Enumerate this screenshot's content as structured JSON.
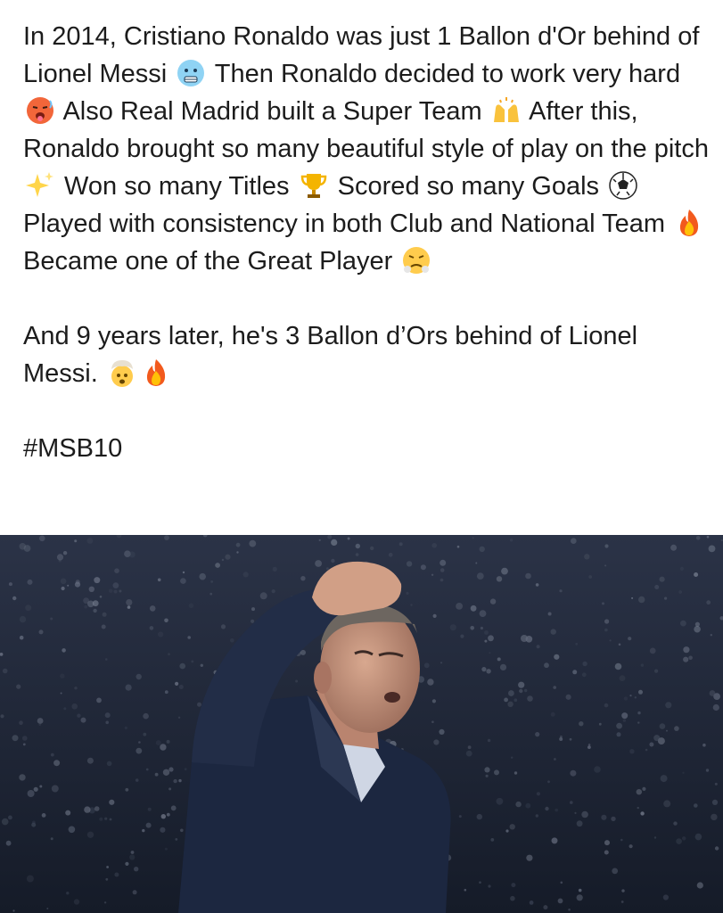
{
  "post": {
    "paragraph_1": [
      {
        "t": "In 2014, Cristiano Ronaldo was just 1 Ballon d'Or behind of Lionel Messi "
      },
      {
        "e": "cold-face-icon"
      },
      {
        "t": " Then Ronaldo decided to work very hard "
      },
      {
        "e": "hot-face-icon"
      },
      {
        "t": " Also Real Madrid built a Super Team "
      },
      {
        "e": "raising-hands-icon"
      },
      {
        "t": " After this, Ronaldo brought so many beautiful style of play on the pitch "
      },
      {
        "e": "sparkles-icon"
      },
      {
        "t": " Won so many Titles "
      },
      {
        "e": "trophy-icon"
      },
      {
        "t": " Scored so many Goals "
      },
      {
        "e": "soccer-ball-icon"
      },
      {
        "t": " Played with consistency in both Club and National Team "
      },
      {
        "e": "fire-icon"
      },
      {
        "t": " Became one of the Great Player "
      },
      {
        "e": "steam-nose-face-icon"
      }
    ],
    "paragraph_2": [
      {
        "t": "And 9 years later, he's 3 Ballon d’Ors behind of Lionel Messi. "
      },
      {
        "e": "exploding-head-icon"
      },
      {
        "e": "fire-icon"
      }
    ],
    "hashtag": "#MSB10"
  },
  "photo": {
    "subject": "man in dark coat holding hand on head in stadium crowd"
  }
}
